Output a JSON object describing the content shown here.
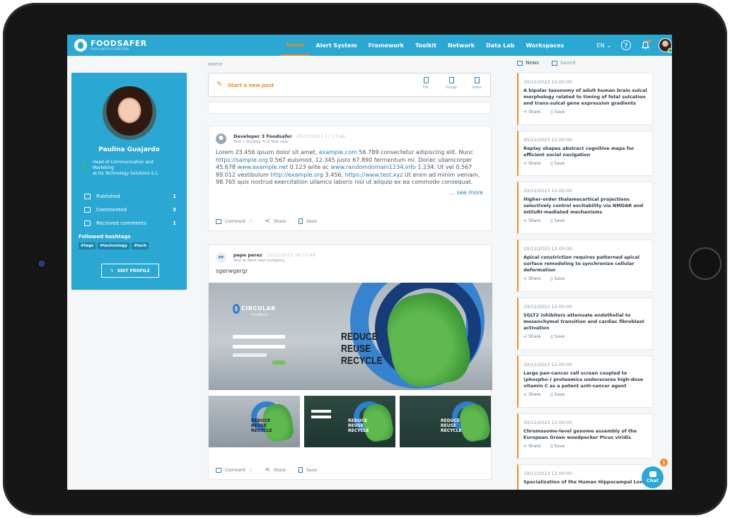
{
  "brand": {
    "name": "FOODSAFER",
    "tagline": "FOOD SAFETY ECOSYSTEM"
  },
  "nav": {
    "items": [
      {
        "label": "Home",
        "active": true
      },
      {
        "label": "Alert System"
      },
      {
        "label": "Framework"
      },
      {
        "label": "Toolkit"
      },
      {
        "label": "Network"
      },
      {
        "label": "Data Lab"
      },
      {
        "label": "Workspaces"
      }
    ],
    "language": "EN",
    "help_glyph": "?"
  },
  "profile": {
    "name": "Paulina Guajardo",
    "role_line1": "Head of Communication and",
    "role_line2": "Marketing",
    "role_line3": "at Ita Technology Solutions S.L.",
    "stats": [
      {
        "label": "Published",
        "value": "1"
      },
      {
        "label": "Commented",
        "value": "3"
      },
      {
        "label": "Received comments",
        "value": "1"
      }
    ],
    "followed_label": "Followed hashtags",
    "hashtags": [
      "#tags",
      "#technology",
      "#tech"
    ],
    "edit_label": "EDIT PROFILE"
  },
  "breadcrumb": "Home",
  "new_post": {
    "label": "Start a new post",
    "tools": [
      {
        "label": "File",
        "icon": "file-icon"
      },
      {
        "label": "Image",
        "icon": "image-icon"
      },
      {
        "label": "Video",
        "icon": "video-icon"
      }
    ]
  },
  "post1": {
    "author": "Developer 3 Foodsafer",
    "date": "20/12/2023 17:13:46",
    "subtitle": "Test • Student 4 of Test new",
    "text": "Lorem 23.456 ipsum dolor sit amet, example.com 56.789 consectetur adipiscing elit. Nunc https://sample.org 0.567 euismod, 12.345 justo 67.890 fermentum mi. Donec ullamcorper 45.678 www.example.net 0.123 ante ac www.randomdomain1234.info 1.234. Ut vel 0.567 89.012 vestibulum http://example.org 3.456. https://www.test.xyz Ut enim ad minim veniam, 98.765 quis nostrud exercitation ullamco laboris nisi ut aliquip ex ea commodo consequat.",
    "see_more": "... see more",
    "comment_label": "Comment",
    "comment_count": "0",
    "share_label": "Share",
    "save_label": "Save"
  },
  "post2": {
    "author": "pepe perez",
    "avatar_initials": "PP",
    "date": "20/12/2023 16:37:48",
    "subtitle": "Test at Alert test company",
    "text": "sgerwgergr",
    "image_brand": "CIRCULAR",
    "image_brand_sub": "FoodPack",
    "image_headline": [
      "REDUCE",
      "REUSE",
      "RECYCLE"
    ],
    "comment_label": "Comment",
    "comment_count": "0",
    "share_label": "Share",
    "save_label": "Save"
  },
  "news": {
    "tabs": [
      {
        "label": "News",
        "active": true
      },
      {
        "label": "Saved"
      }
    ],
    "share_label": "Share",
    "save_label": "Save",
    "items": [
      {
        "date": "20/12/2023 12:00:00",
        "title": "A bipolar taxonomy of adult human brain sulcal morphology related to timing of fetal sulcation and trans-sulcal gene expression gradients"
      },
      {
        "date": "20/12/2023 12:00:00",
        "title": "Replay shapes abstract cognitive maps for efficient social navigation"
      },
      {
        "date": "20/12/2023 12:00:00",
        "title": "Higher-order thalamocortical projections selectively control excitability via NMDAR and mGluRI-mediated mechanisms"
      },
      {
        "date": "20/12/2023 12:00:00",
        "title": "Apical constriction requires patterned apical surface remodeling to synchronize cellular deformation"
      },
      {
        "date": "20/12/2023 12:00:00",
        "title": "SGLT2 inhibitors attenuate endothelial to mesenchymal transition and cardiac fibroblast activation"
      },
      {
        "date": "20/12/2023 12:00:00",
        "title": "Large pan-cancer cell screen coupled to (phospho-) proteomics underscores high-dose vitamin C as a potent anti-cancer agent"
      },
      {
        "date": "20/12/2023 12:00:00",
        "title": "Chromosome-level genome assembly of the European Green woodpecker Picus viridis"
      },
      {
        "date": "19/12/2023 12:00:00",
        "title": "Specialization of the Human Hippocampal Long"
      }
    ]
  },
  "chat": {
    "label": "Chat",
    "badge": "1"
  },
  "colors": {
    "primary": "#2aa7d3",
    "accent": "#f08a24",
    "link": "#2878b8"
  }
}
